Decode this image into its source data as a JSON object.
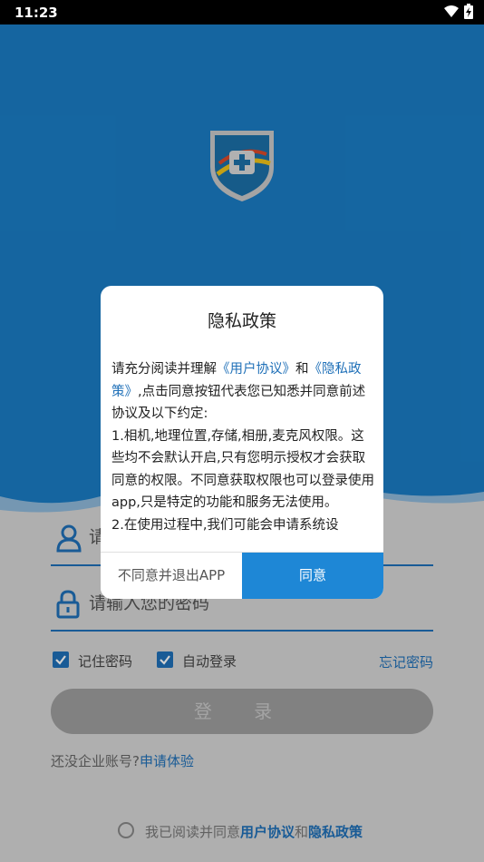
{
  "status_bar": {
    "time": "11:23",
    "wifi_icon": "wifi-icon",
    "battery_icon": "battery-charging-icon"
  },
  "colors": {
    "primary": "#1f70b8",
    "hero_blue": "#1a7cc4",
    "agree_button": "#1e87d6",
    "login_disabled": "#9e9e9e"
  },
  "login_form": {
    "username_placeholder": "请",
    "password_placeholder": "请输入您的密码",
    "remember_password": "记住密码",
    "auto_login": "自动登录",
    "forgot_password": "忘记密码",
    "login_button": "登 录",
    "no_account_text": "还没企业账号?",
    "apply_link": "申请体验",
    "agreement_prefix": "我已阅读并同意",
    "agreement_user": "用户协议",
    "agreement_and": "和",
    "agreement_privacy": "隐私政策"
  },
  "dialog": {
    "title": "隐私政策",
    "intro_prefix": "请充分阅读并理解",
    "user_agreement_link": "《用户协议》",
    "intro_and": "和",
    "privacy_link": "《隐私政策》",
    "intro_suffix": ",点击同意按钮代表您已知悉并同意前述协议及以下约定:",
    "item1": "1.相机,地理位置,存储,相册,麦克风权限。这些均不会默认开启,只有您明示授权才会获取同意的权限。不同意获取权限也可以登录使用app,只是特定的功能和服务无法使用。",
    "item2": "2.在使用过程中,我们可能会申请系统设",
    "decline_button": "不同意并退出APP",
    "agree_button": "同意"
  }
}
